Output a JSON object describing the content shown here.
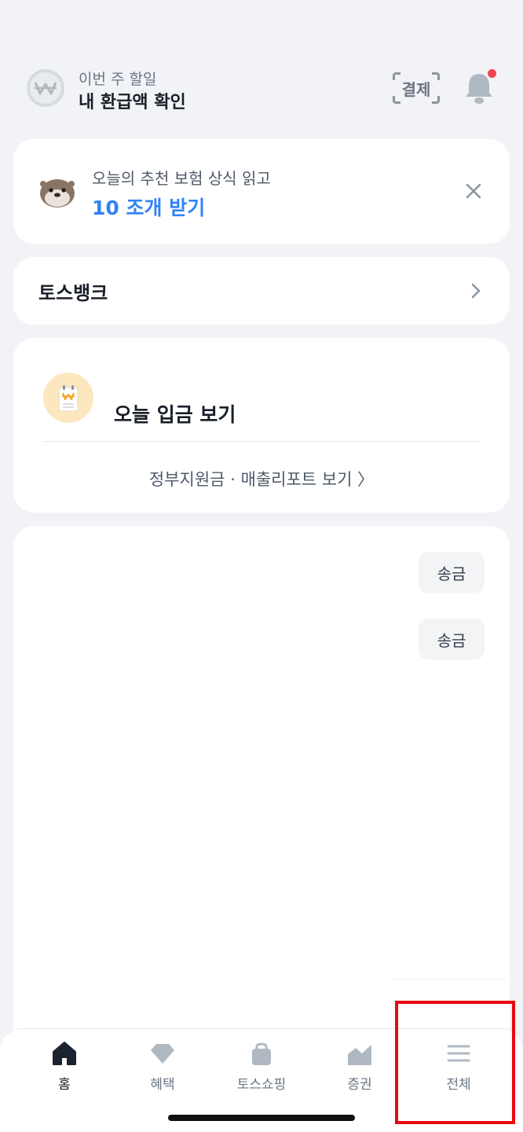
{
  "header": {
    "subtitle": "이번 주 할일",
    "title": "내 환급액 확인",
    "pay_label": "결제",
    "won_icon": "won-icon",
    "bell_icon": "bell-icon"
  },
  "promo": {
    "subtitle": "오늘의 추천 보험 상식 읽고",
    "title": "10 조개 받기",
    "icon": "otter-icon",
    "close_icon": "close-icon"
  },
  "bank": {
    "title": "토스뱅크",
    "chevron_icon": "chevron-right-icon"
  },
  "deposit": {
    "title": "오늘 입금 보기",
    "link": "정부지원금 · 매출리포트 보기 〉",
    "icon": "receipt-won-icon"
  },
  "accounts": {
    "send_buttons": [
      "송금",
      "송금"
    ]
  },
  "tabbar": {
    "tabs": [
      {
        "label": "홈",
        "icon": "home-icon",
        "active": true
      },
      {
        "label": "혜택",
        "icon": "diamond-icon",
        "active": false
      },
      {
        "label": "토스쇼핑",
        "icon": "shopping-bag-icon",
        "active": false
      },
      {
        "label": "증권",
        "icon": "chart-icon",
        "active": false
      },
      {
        "label": "전체",
        "icon": "menu-icon",
        "active": false
      }
    ]
  },
  "colors": {
    "accent": "#3182f6",
    "notification": "#f04452",
    "highlight": "#e8090f",
    "background": "#f2f3f6"
  }
}
